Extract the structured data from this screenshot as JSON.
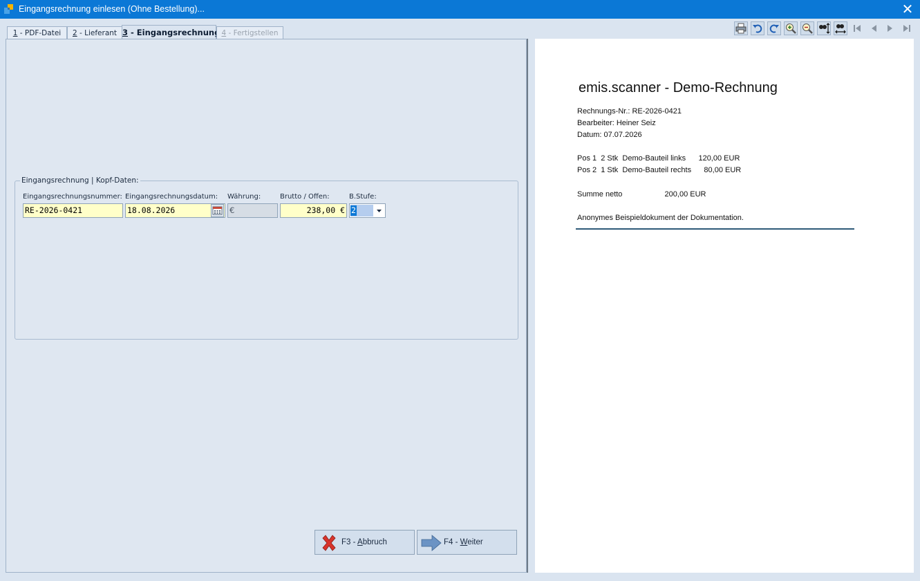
{
  "window": {
    "title": "Eingangsrechnung einlesen (Ohne Bestellung)...",
    "close_glyph": "✕"
  },
  "tabs": [
    {
      "num": "1",
      "label": " - PDF-Datei"
    },
    {
      "num": "2",
      "label": " - Lieferant"
    },
    {
      "num": "3",
      "label": " - Eingangsrechnung"
    },
    {
      "num": "4",
      "label": " - Fertigstellen"
    }
  ],
  "group": {
    "legend": "Eingangsrechnung | Kopf-Daten:",
    "labels": {
      "number": "Eingangsrechnungsnummer:",
      "date": "Eingangsrechnungsdatum:",
      "currency": "Währung:",
      "gross": "Brutto / Offen:",
      "level": "B.Stufe:"
    },
    "values": {
      "number": "RE-2026-0421",
      "date": "18.08.2026",
      "currency": "€",
      "gross": "238,00 €",
      "level": "2"
    }
  },
  "buttons": {
    "cancel": {
      "pre": "F3 - ",
      "key": "A",
      "rest": "bbruch"
    },
    "next": {
      "pre": "F4 - ",
      "key": "W",
      "rest": "eiter"
    }
  },
  "toolbar_icons": [
    "print-icon",
    "undo-icon",
    "redo-icon",
    "zoom-in-icon",
    "zoom-out-icon",
    "fit-height-icon",
    "fit-width-icon",
    "first-page-icon",
    "prev-page-icon",
    "next-page-icon",
    "last-page-icon"
  ],
  "document": {
    "title": "emis.scanner - Demo-Rechnung",
    "lines": [
      "Rechnungs-Nr.: RE-2026-0421",
      "Bearbeiter: Heiner Seiz",
      "Datum: 07.07.2026",
      "Pos 1  2 Stk  Demo-Bauteil links      120,00 EUR",
      "Pos 2  1 Stk  Demo-Bauteil rechts      80,00 EUR",
      "Summe netto                    200,00 EUR",
      "Anonymes Beispieldokument der Dokumentation."
    ]
  },
  "colors": {
    "titlebar": "#0b78d6",
    "field_yellow": "#ffffc9",
    "doc_rule": "#2e5a78"
  }
}
